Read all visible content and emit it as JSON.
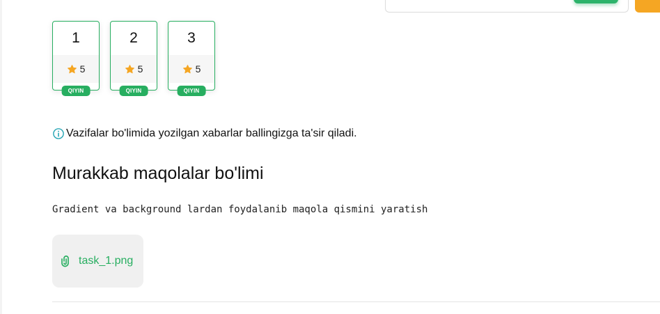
{
  "colors": {
    "accent_green": "#27ae60",
    "star_orange": "#f5a623",
    "info_teal": "#1aa0b0"
  },
  "tasks": [
    {
      "number": "1",
      "rating": "5",
      "difficulty": "QIYIN"
    },
    {
      "number": "2",
      "rating": "5",
      "difficulty": "QIYIN"
    },
    {
      "number": "3",
      "rating": "5",
      "difficulty": "QIYIN"
    }
  ],
  "notice": {
    "icon": "info-icon",
    "text": "Vazifalar bo'limida yozilgan xabarlar ballingizga ta'sir qiladi."
  },
  "section": {
    "title": "Murakkab maqolalar bo'limi",
    "description": "Gradient va background lardan foydalanib maqola qismini yaratish"
  },
  "attachment": {
    "icon": "paperclip-icon",
    "file_name": "task_1.png"
  }
}
